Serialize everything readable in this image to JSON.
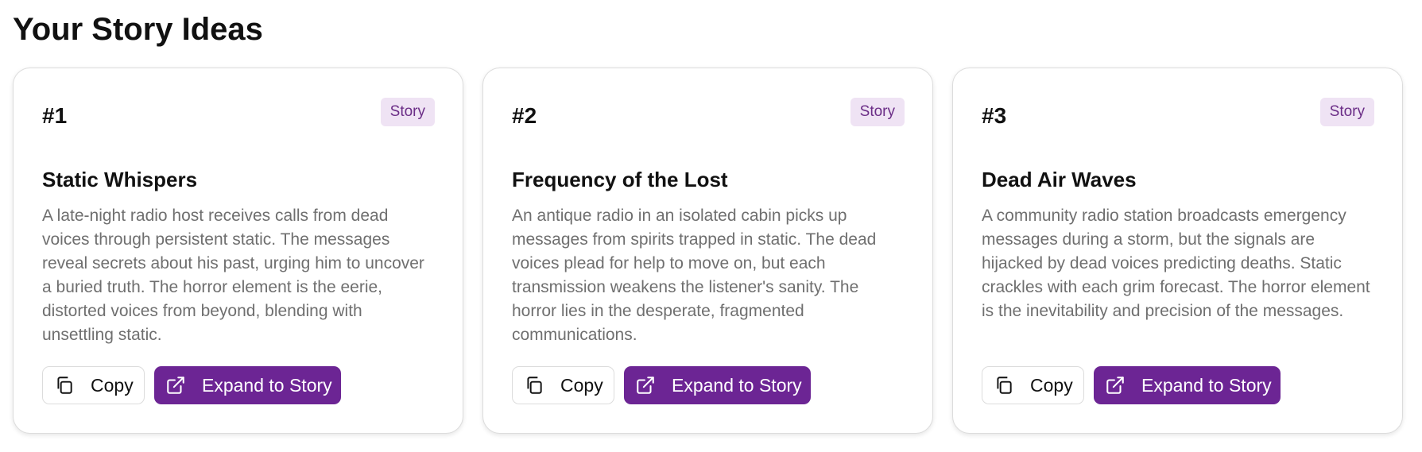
{
  "page": {
    "title": "Your Story Ideas"
  },
  "colors": {
    "accent": "#6c2594",
    "badge_bg": "#efe3f4",
    "badge_text": "#6b2d87",
    "description_text": "#6f6f6f"
  },
  "cards": [
    {
      "number": "#1",
      "badge": "Story",
      "title": "Static Whispers",
      "description": "A late-night radio host receives calls from dead voices through persistent static. The messages reveal secrets about his past, urging him to uncover a buried truth. The horror element is the eerie, distorted voices from beyond, blending with unsettling static.",
      "copy_label": "Copy",
      "expand_label": "Expand to Story",
      "copy_icon": "copy-icon",
      "expand_icon": "external-link-icon"
    },
    {
      "number": "#2",
      "badge": "Story",
      "title": "Frequency of the Lost",
      "description": "An antique radio in an isolated cabin picks up messages from spirits trapped in static. The dead voices plead for help to move on, but each transmission weakens the listener's sanity. The horror lies in the desperate, fragmented communications.",
      "copy_label": "Copy",
      "expand_label": "Expand to Story",
      "copy_icon": "copy-icon",
      "expand_icon": "external-link-icon"
    },
    {
      "number": "#3",
      "badge": "Story",
      "title": "Dead Air Waves",
      "description": "A community radio station broadcasts emergency messages during a storm, but the signals are hijacked by dead voices predicting deaths. Static crackles with each grim forecast. The horror element is the inevitability and precision of the messages.",
      "copy_label": "Copy",
      "expand_label": "Expand to Story",
      "copy_icon": "copy-icon",
      "expand_icon": "external-link-icon"
    }
  ]
}
